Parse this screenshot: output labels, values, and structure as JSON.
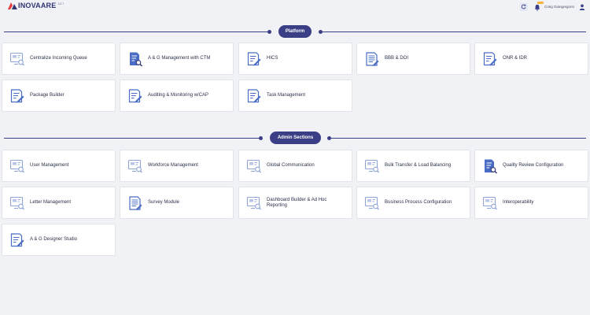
{
  "header": {
    "brand_name": "INOVAARE",
    "brand_version": "3.6.7",
    "user_name": "Craig Giangregorio"
  },
  "sections": {
    "platform": {
      "title": "Platform",
      "cards": [
        {
          "label": "Centralize Incoming Queue",
          "icon": "monitor-search-icon"
        },
        {
          "label": "A & G Management with CTM",
          "icon": "document-search-icon"
        },
        {
          "label": "HICS",
          "icon": "document-edit-icon"
        },
        {
          "label": "BBB & DOI",
          "icon": "document-list-icon"
        },
        {
          "label": "ONR & IDR",
          "icon": "document-edit-icon"
        },
        {
          "label": "Package Builder",
          "icon": "document-edit-icon"
        },
        {
          "label": "Auditing & Monitoring w/CAP",
          "icon": "document-edit-icon"
        },
        {
          "label": "Task Management",
          "icon": "document-edit-icon"
        }
      ]
    },
    "admin": {
      "title": "Admin Sections",
      "cards": [
        {
          "label": "User Management",
          "icon": "monitor-search-icon"
        },
        {
          "label": "Workforce Management",
          "icon": "monitor-search-icon"
        },
        {
          "label": "Global Communication",
          "icon": "monitor-search-icon"
        },
        {
          "label": "Bulk Transfer & Load Balancing",
          "icon": "monitor-search-icon"
        },
        {
          "label": "Quality Review Configuration",
          "icon": "document-search-icon"
        },
        {
          "label": "Letter Management",
          "icon": "monitor-search-icon"
        },
        {
          "label": "Survey Module",
          "icon": "document-list-icon"
        },
        {
          "label": "Dashboard Builder & Ad Hoc Reporting",
          "icon": "monitor-search-icon"
        },
        {
          "label": "Business Process Configuration",
          "icon": "monitor-search-icon"
        },
        {
          "label": "Interoperability",
          "icon": "monitor-search-icon"
        },
        {
          "label": "A & G Designer Studio",
          "icon": "document-edit-icon"
        }
      ]
    }
  },
  "colors": {
    "accent": "#3a3f85",
    "icon_blue": "#4a6cc4",
    "icon_light": "#8fa4d6",
    "badge": "#f7b23b",
    "background": "#f1f2f6"
  }
}
